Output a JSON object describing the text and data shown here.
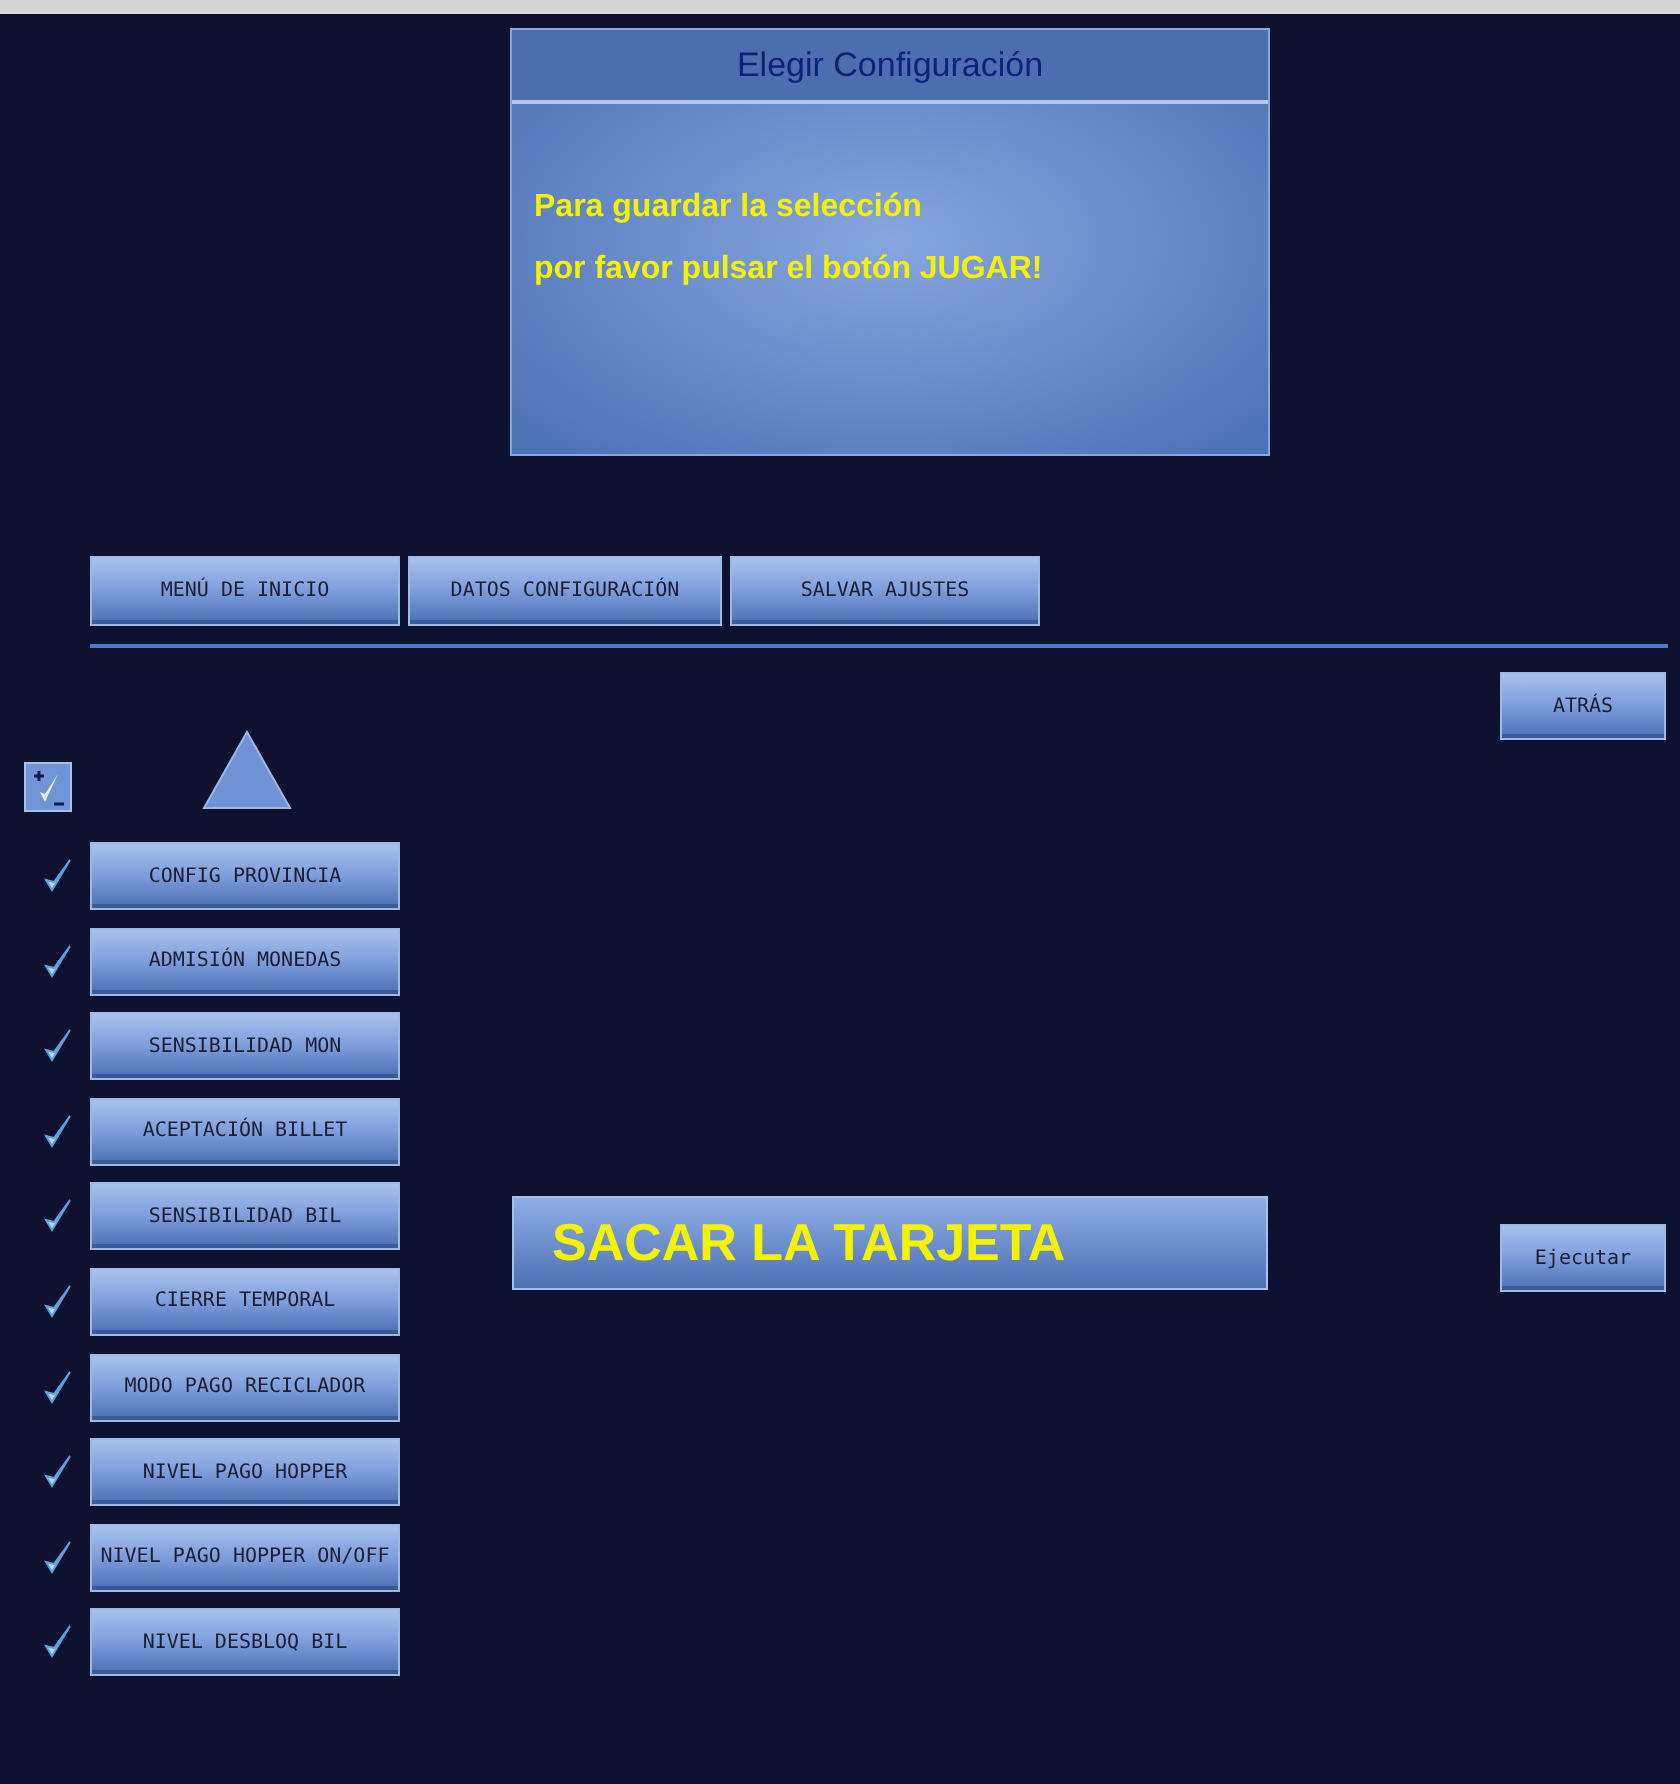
{
  "dialog": {
    "title": "Elegir Configuración",
    "lines": [
      "Para guardar la selección",
      "por favor pulsar el botón JUGAR!"
    ]
  },
  "nav_buttons": [
    "MENÚ DE INICIO",
    "DATOS CONFIGURACIÓN",
    "SALVAR AJUSTES"
  ],
  "back_button": "ATRÁS",
  "options": [
    {
      "label": "CONFIG PROVINCIA",
      "checked": true
    },
    {
      "label": "ADMISIÓN MONEDAS",
      "checked": true
    },
    {
      "label": "SENSIBILIDAD MON",
      "checked": true
    },
    {
      "label": "ACEPTACIÓN BILLET",
      "checked": true
    },
    {
      "label": "SENSIBILIDAD BIL",
      "checked": true
    },
    {
      "label": "CIERRE TEMPORAL",
      "checked": true
    },
    {
      "label": "MODO PAGO RECICLADOR",
      "checked": true
    },
    {
      "label": "NIVEL PAGO HOPPER",
      "checked": true
    },
    {
      "label": "NIVEL PAGO HOPPER ON/OFF",
      "checked": true
    },
    {
      "label": "NIVEL DESBLOQ BIL",
      "checked": true
    }
  ],
  "message": "SACAR LA TARJETA",
  "execute_button": "Ejecutar"
}
